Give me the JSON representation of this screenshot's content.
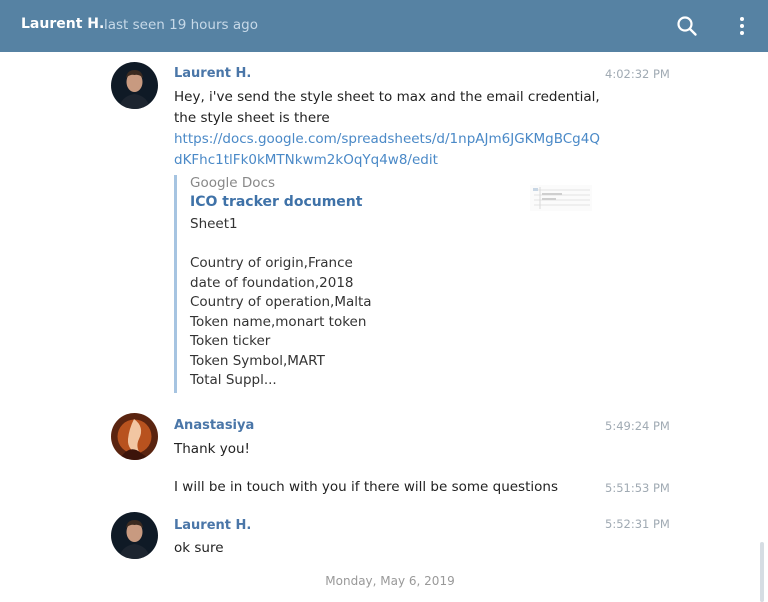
{
  "header": {
    "name": "Laurent H.",
    "status": "last seen 19 hours ago",
    "icons": {
      "search": "search-icon",
      "more": "more-vertical-icon"
    },
    "bar_color": "#5682a3"
  },
  "messages": [
    {
      "sender": "Laurent H.",
      "time": "4:02:32 PM",
      "text": "Hey, i've send the style sheet to max and the email credential, the style sheet is there",
      "link": "https://docs.google.com/spreadsheets/d/1npAJm6JGKMgBCg4QdKFhc1tlFk0kMTNkwm2kOqYq4w8/edit",
      "preview": {
        "site": "Google Docs",
        "title": "ICO tracker document",
        "body": "Sheet1\n\nCountry of origin,France\ndate of foundation,2018\nCountry of operation,Malta\nToken name,monart token\nToken ticker\nToken Symbol,MART\nTotal Suppl..."
      }
    },
    {
      "sender": "Anastasiya",
      "time": "5:49:24 PM",
      "text": "Thank you!"
    },
    {
      "time": "5:51:53 PM",
      "text": "I will be in touch with you if there will be some questions"
    },
    {
      "sender": "Laurent H.",
      "time": "5:52:31 PM",
      "text": "ok sure"
    }
  ],
  "date_divider": "Monday, May 6, 2019",
  "colors": {
    "sender": "#4a76a8",
    "link": "#4a89c7",
    "timestamp": "#a0aab3",
    "preview_border": "#a6c4e1"
  }
}
